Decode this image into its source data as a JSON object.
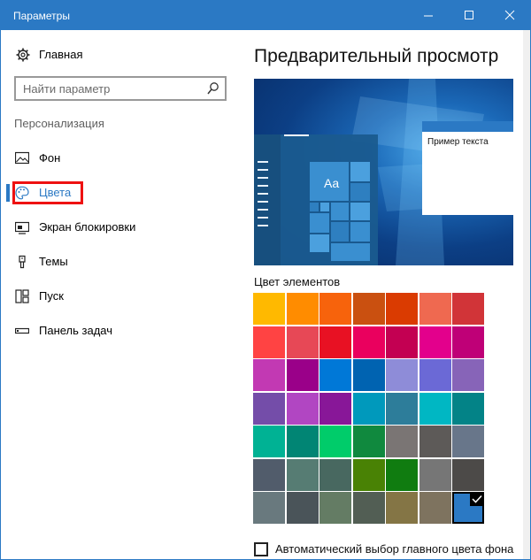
{
  "window": {
    "title": "Параметры"
  },
  "sidebar": {
    "home_label": "Главная",
    "search_placeholder": "Найти параметр",
    "section_heading": "Персонализация",
    "items": [
      {
        "label": "Фон",
        "icon": "image-icon",
        "active": false
      },
      {
        "label": "Цвета",
        "icon": "palette-icon",
        "active": true
      },
      {
        "label": "Экран блокировки",
        "icon": "lock-screen-icon",
        "active": false
      },
      {
        "label": "Темы",
        "icon": "themes-icon",
        "active": false
      },
      {
        "label": "Пуск",
        "icon": "start-icon",
        "active": false
      },
      {
        "label": "Панель задач",
        "icon": "taskbar-icon",
        "active": false
      }
    ]
  },
  "main": {
    "preview_title": "Предварительный просмотр",
    "preview_sample_text": "Пример текста",
    "preview_tile_text": "Aa",
    "colors_label": "Цвет элементов",
    "auto_color_label": "Автоматический выбор главного цвета фона",
    "auto_color_checked": false,
    "accent_color": "#2b79c4",
    "selected_swatch_index": 48,
    "swatches": [
      "#ffb900",
      "#ff8c00",
      "#f7630c",
      "#ca5010",
      "#da3b01",
      "#ef6950",
      "#d13438",
      "#ff4343",
      "#e74856",
      "#e81123",
      "#ea005e",
      "#c30052",
      "#e3008c",
      "#bf0077",
      "#c239b3",
      "#9a0089",
      "#0078d7",
      "#0063b1",
      "#8e8cd8",
      "#6b69d6",
      "#8764b8",
      "#744da9",
      "#b146c2",
      "#881798",
      "#0099bc",
      "#2d7d9a",
      "#00b7c3",
      "#038387",
      "#00b294",
      "#018574",
      "#00cc6a",
      "#10893e",
      "#7a7574",
      "#5d5a58",
      "#68768a",
      "#515c6b",
      "#567c73",
      "#486860",
      "#498205",
      "#107c10",
      "#767676",
      "#4c4a48",
      "#69797e",
      "#4a5459",
      "#647c64",
      "#525e54",
      "#847545",
      "#7e735f",
      "#2b79c4"
    ]
  }
}
